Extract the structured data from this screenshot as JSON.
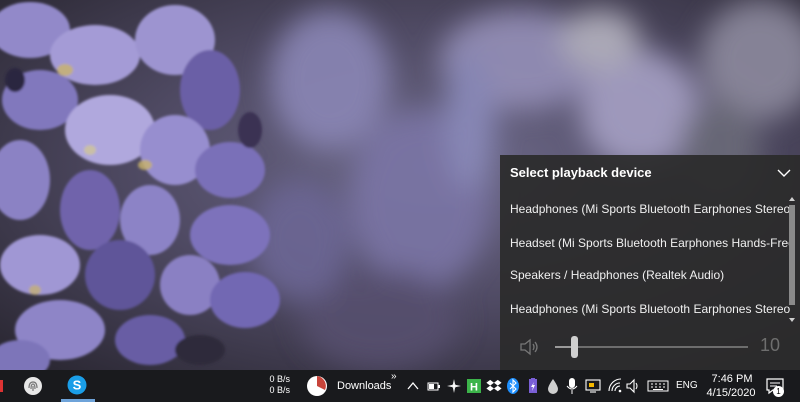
{
  "playback_flyout": {
    "title": "Select playback device",
    "devices": [
      {
        "label": "Headphones (Mi Sports Bluetooth Earphones Stereo)"
      },
      {
        "label": "Headset (Mi Sports Bluetooth Earphones Hands-Free..."
      },
      {
        "label": "Speakers / Headphones (Realtek Audio)"
      },
      {
        "label": "Headphones (Mi Sports Bluetooth Earphones Stereo)"
      }
    ],
    "volume": {
      "value": "10",
      "level": 0.1
    }
  },
  "taskbar": {
    "apps": [
      {
        "icon": "fingerprint-app-icon"
      },
      {
        "icon": "skype-icon",
        "label": "S"
      }
    ],
    "net_upload": "0 B/s",
    "net_download": "0 B/s",
    "downloads_label": "Downloads",
    "overflow_label": "»",
    "tray_icons": [
      "chevron-up-icon",
      "battery-icon",
      "fan-icon",
      "app-green-icon",
      "dropbox-icon",
      "bluetooth-icon",
      "battery-monitor-icon",
      "ink-drop-icon",
      "microphone-icon",
      "display-icon",
      "wifi-icon",
      "speaker-icon",
      "keyboard-icon"
    ],
    "green_app_label": "H",
    "language": "ENG",
    "clock_time": "7:46 PM",
    "clock_date": "4/15/2020",
    "notification_count": "1"
  },
  "colors": {
    "flyout_bg": "#2b2b2b",
    "taskbar_bg": "#191a1d",
    "accent_blue": "#1e90ff",
    "wallpaper_purple": "#7b74b0"
  }
}
